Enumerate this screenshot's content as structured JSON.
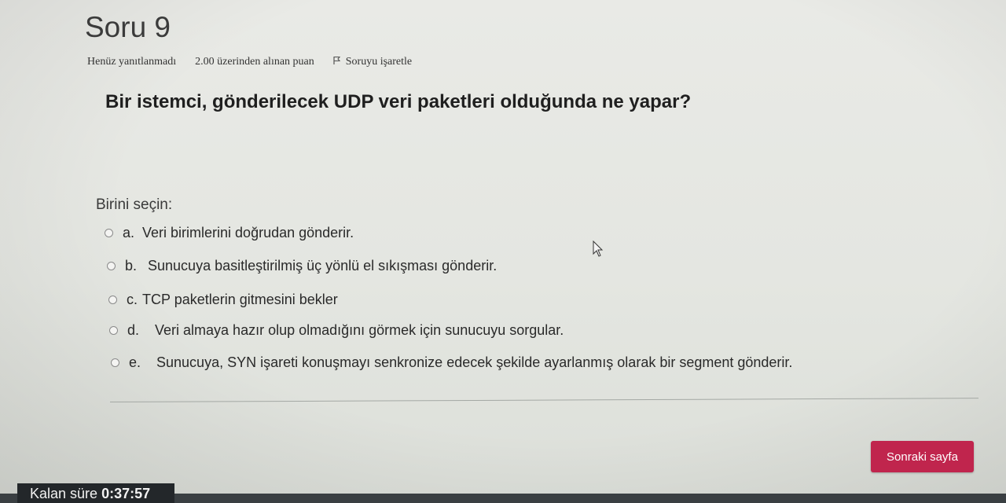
{
  "header": {
    "title": "Soru 9",
    "status": "Henüz yanıtlanmadı",
    "grade": "2.00 üzerinden alınan puan",
    "flag_icon": "flag-icon",
    "flag_label": "Soruyu işaretle"
  },
  "question": {
    "text": "Bir istemci, gönderilecek UDP veri paketleri olduğunda ne yapar?",
    "prompt": "Birini seçin:"
  },
  "answers": [
    {
      "letter": "a.",
      "text": "Veri birimlerini doğrudan gönderir."
    },
    {
      "letter": "b.",
      "text": "Sunucuya basitleştirilmiş üç yönlü el sıkışması gönderir."
    },
    {
      "letter": "c.",
      "text": "TCP paketlerin gitmesini bekler"
    },
    {
      "letter": "d.",
      "text": "Veri almaya hazır olup olmadığını görmek için sunucuyu sorgular."
    },
    {
      "letter": "e.",
      "text": "Sunucuya, SYN işareti konuşmayı senkronize edecek şekilde ayarlanmış olarak bir segment gönderir."
    }
  ],
  "navigation": {
    "next_label": "Sonraki sayfa"
  },
  "timer": {
    "label": "Kalan süre",
    "value": "0:37:57"
  },
  "colors": {
    "accent": "#c0254d",
    "timer_bg": "#23272a"
  }
}
